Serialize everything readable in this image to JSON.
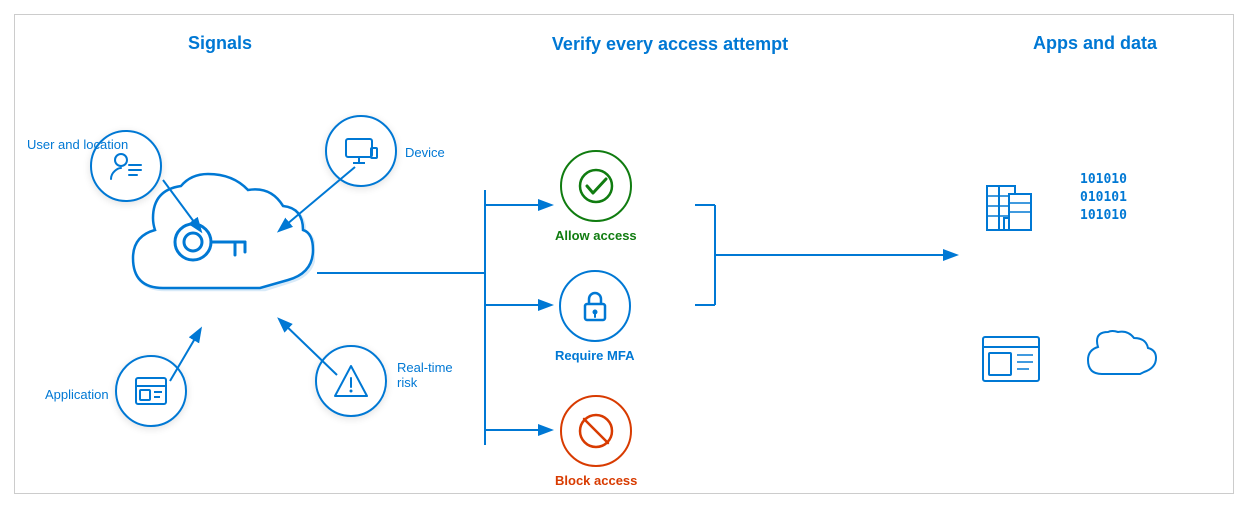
{
  "sections": {
    "signals": {
      "title": "Signals",
      "items": [
        {
          "id": "user-location",
          "label": "User and location"
        },
        {
          "id": "device",
          "label": "Device"
        },
        {
          "id": "application",
          "label": "Application"
        },
        {
          "id": "realtime-risk",
          "label": "Real-time\nrisk"
        }
      ]
    },
    "verify": {
      "title": "Verify every access attempt",
      "outcomes": [
        {
          "id": "allow",
          "label": "Allow access",
          "color": "#107c10"
        },
        {
          "id": "mfa",
          "label": "Require MFA",
          "color": "#0078d4"
        },
        {
          "id": "block",
          "label": "Block access",
          "color": "#d83b01"
        }
      ]
    },
    "apps": {
      "title": "Apps and data",
      "items": [
        {
          "id": "building"
        },
        {
          "id": "binary-data"
        },
        {
          "id": "dashboard"
        },
        {
          "id": "cloud"
        }
      ]
    }
  },
  "colors": {
    "blue": "#0078d4",
    "green": "#107c10",
    "red": "#d83b01",
    "cloud_bg": "#0078d4",
    "circle_bg": "#fff",
    "border": "#ccc"
  }
}
